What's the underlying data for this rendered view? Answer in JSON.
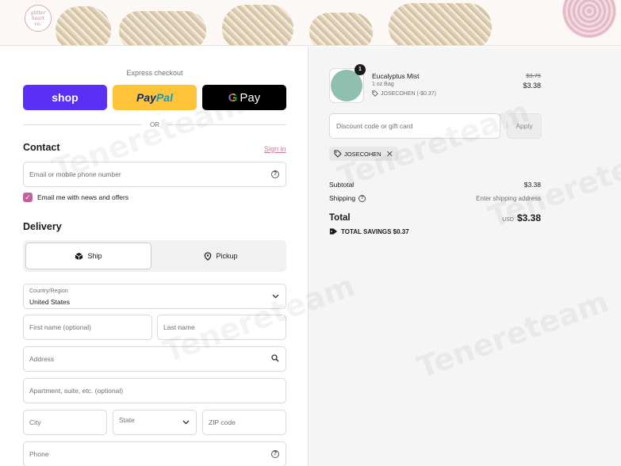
{
  "banner": {
    "logo_text": "glitter\nheart\nco."
  },
  "express": {
    "label": "Express checkout",
    "shop_label": "shop",
    "paypal_part1": "Pay",
    "paypal_part2": "Pal",
    "gpay_g": "G",
    "gpay_label": "Pay",
    "or_label": "OR"
  },
  "contact": {
    "heading": "Contact",
    "signin_label": "Sign in",
    "email_placeholder": "Email or mobile phone number",
    "newsletter_label": "Email me with news and offers",
    "newsletter_checked": true
  },
  "delivery": {
    "heading": "Delivery",
    "ship_label": "Ship",
    "pickup_label": "Pickup",
    "country_label": "Country/Region",
    "country_value": "United States",
    "first_name": "First name (optional)",
    "last_name": "Last name",
    "address": "Address",
    "apartment": "Apartment, suite, etc. (optional)",
    "city": "City",
    "state": "State",
    "zip": "ZIP code",
    "phone": "Phone"
  },
  "summary": {
    "item": {
      "quantity": "1",
      "name": "Eucalyptus Mist",
      "variant": "1 oz Bag",
      "discount": "JOSECOHEN (-$0.37)",
      "original_price": "$3.75",
      "price": "$3.38"
    },
    "discount_placeholder": "Discount code or gift card",
    "apply_label": "Apply",
    "applied_code": "JOSECOHEN",
    "subtotal_label": "Subtotal",
    "subtotal_value": "$3.38",
    "shipping_label": "Shipping",
    "shipping_value": "Enter shipping address",
    "total_label": "Total",
    "total_currency": "USD",
    "total_value": "$3.38",
    "savings_label": "TOTAL SAVINGS",
    "savings_value": "$0.37"
  },
  "watermark": "Tenereteam",
  "colors": {
    "shop": "#5a31f4",
    "paypal": "#ffc439",
    "gpay": "#000000",
    "accent": "#c2609a"
  }
}
